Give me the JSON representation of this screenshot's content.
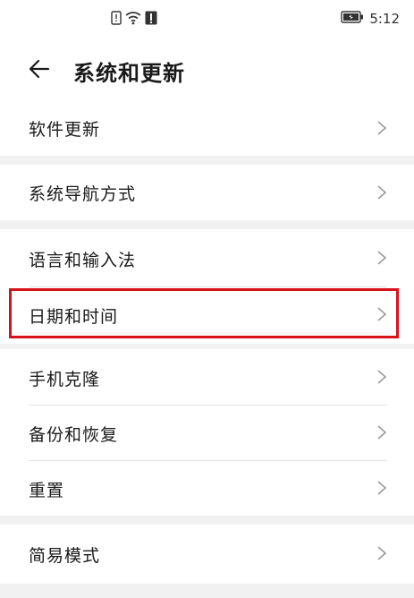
{
  "status_bar": {
    "time": "5:12",
    "icons": [
      "sim-icon",
      "wifi-icon",
      "notification-icon",
      "battery-icon"
    ]
  },
  "header": {
    "back_icon": "arrow-left-icon",
    "title": "系统和更新"
  },
  "items": [
    {
      "label": "软件更新"
    },
    {
      "label": "系统导航方式"
    },
    {
      "label": "语言和输入法"
    },
    {
      "label": "日期和时间",
      "highlighted": true
    },
    {
      "label": "手机克隆"
    },
    {
      "label": "备份和恢复"
    },
    {
      "label": "重置"
    },
    {
      "label": "简易模式"
    }
  ],
  "colors": {
    "highlight_border": "#d8121a",
    "background": "#f1f1f1",
    "card": "#ffffff"
  }
}
